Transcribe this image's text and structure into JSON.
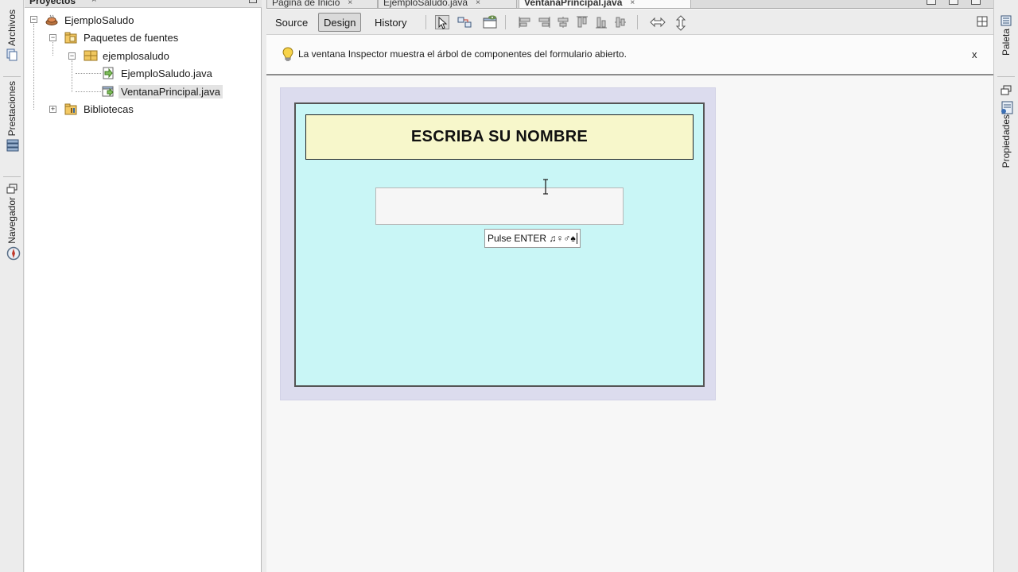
{
  "left_strip": {
    "tabs": [
      {
        "label": "Archivos",
        "icon": "files-icon"
      },
      {
        "label": "Prestaciones",
        "icon": "services-icon"
      },
      {
        "label": "Navegador",
        "icon": "navigator-icon"
      }
    ]
  },
  "projects": {
    "title": "Proyectos",
    "close_glyph": "×",
    "tree": [
      {
        "label": "EjemploSaludo",
        "icon": "coffee-project-icon",
        "expander": "−"
      },
      {
        "label": "Paquetes de fuentes",
        "icon": "source-packages-icon",
        "expander": "−"
      },
      {
        "label": "ejemplosaludo",
        "icon": "package-icon",
        "expander": "−"
      },
      {
        "label": "EjemploSaludo.java",
        "icon": "java-file-icon"
      },
      {
        "label": "VentanaPrincipal.java",
        "icon": "java-form-icon",
        "selected": true
      },
      {
        "label": "Bibliotecas",
        "icon": "libraries-icon",
        "expander": "+"
      }
    ]
  },
  "editor": {
    "tabs": [
      {
        "label": "Página de Inicio",
        "close": "×"
      },
      {
        "label": "EjemploSaludo.java",
        "close": "×"
      },
      {
        "label": "VentanaPrincipal.java",
        "close": "×",
        "active": true
      }
    ],
    "toolbar": {
      "source": "Source",
      "design": "Design",
      "history": "History"
    },
    "inspector_message": "La ventana Inspector muestra el árbol de componentes del formulario abierto.",
    "inspector_close": "x",
    "form": {
      "title": "ESCRIBA SU NOMBRE",
      "input_value": "",
      "enter_label": "Pulse ENTER ♫♀♂♠"
    }
  },
  "right_strip": {
    "tabs": [
      {
        "label": "Paleta",
        "icon": "palette-icon"
      },
      {
        "label": "Propiedades",
        "icon": "properties-icon"
      }
    ]
  },
  "colors": {
    "form_background": "#c9f6f6",
    "title_background": "#f7f7cb",
    "frame_background": "#dcdcee"
  }
}
